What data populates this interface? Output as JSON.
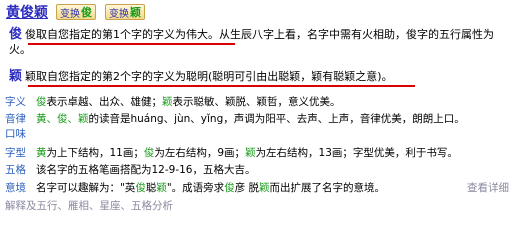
{
  "header": {
    "title": "黄俊颖",
    "swap1_prefix": "变换",
    "swap1_char": "俊",
    "swap2_prefix": "变换",
    "swap2_char": "颖"
  },
  "char1": {
    "char": "俊",
    "underlined": "俊取自您指定的第1个字的字义为伟大。",
    "rest": "从生辰八字上看，名字中需有火相助，俊字的五行属性为火。"
  },
  "char2": {
    "char": "颖",
    "underlined": "颖取自您指定的第2个字的字义为聪明(聪明可引由出聪颖，颖有聪颖之意)。"
  },
  "details": {
    "meaning_label": "字义",
    "meaning_parts": [
      "俊",
      "表示卓越、出众、雄健；",
      "颖",
      "表示聪敏、颖脱、颖哲，意义优美。"
    ],
    "sound_label1": "音律",
    "sound_label2": "口味",
    "sound_parts": [
      "黄、俊、颖",
      "的读音是huáng、jùn、yǐng，声调为阳平、去声、上声，音律优美，朗朗上口。"
    ],
    "shape_label": "字型",
    "shape_parts": [
      "黄",
      "为上下结构，11画；",
      "俊",
      "为左右结构，9画；",
      "颖",
      "为左右结构，13画；字型优美，利于书写。"
    ],
    "wuge_label": "五格",
    "wuge_text": "该名字的五格笔画搭配为12-9-16，五格大吉。",
    "img_label": "意境",
    "img_parts": [
      "名字可以趣解为：\"英",
      "俊",
      "聪",
      "颖",
      "\"。成语旁求",
      "俊",
      "彦 脱",
      "颖",
      "而出扩展了名字的意境。"
    ],
    "more": "查看详细"
  },
  "footer": {
    "links": [
      "解释及五行",
      "、",
      "雁相",
      "、",
      "星座",
      "、",
      "五格分析"
    ]
  }
}
